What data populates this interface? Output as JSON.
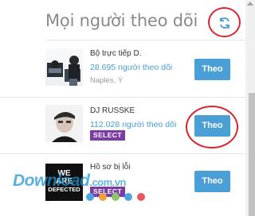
{
  "panel": {
    "title": "Mọi người theo dõi",
    "refresh_icon": "refresh-icon"
  },
  "accounts": [
    {
      "name": "Bộ trực tiếp D.",
      "followers": "28.695 người theo dõi",
      "location": "Naples, Ý",
      "button": "Theo"
    },
    {
      "name": "DJ RUSSKE",
      "followers": "112.028 người theo dõi",
      "badge": "SELECT",
      "button": "Theo"
    },
    {
      "name": "Hồ sơ bị lỗi",
      "avatar_text_line1": "WE",
      "avatar_text_line2": "ARE",
      "avatar_text_line3": "DEFECTED",
      "badge": "SELECT",
      "button": "Theo"
    }
  ],
  "watermark": {
    "text": "Download",
    "tld": ".com.vn"
  },
  "colors": {
    "accent": "#4a9fd6",
    "badge": "#7b3ca5",
    "annotation": "#d9262c",
    "dots": [
      "#4fa3df",
      "#f0a23a",
      "#8cc56a",
      "#4fa3df",
      "#e6565c"
    ]
  }
}
